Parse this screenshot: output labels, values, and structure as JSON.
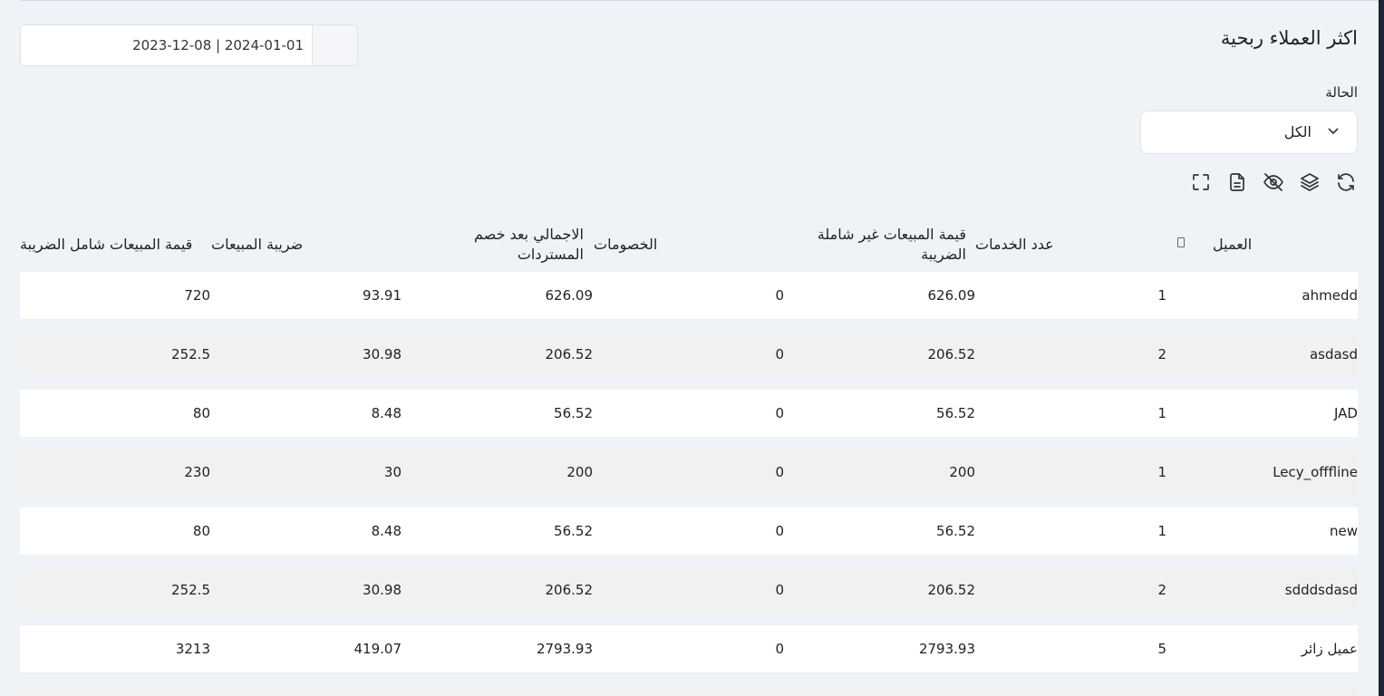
{
  "page": {
    "title": "اكثر العملاء ربحية",
    "date_range": "2023-12-08 | 2024-01-01"
  },
  "filter": {
    "status_label": "الحالة",
    "status_value": "الكل"
  },
  "toolbar": {
    "icons": [
      "refresh-icon",
      "layers-icon",
      "eye-off-icon",
      "document-icon",
      "fullscreen-icon"
    ]
  },
  "table": {
    "headers": {
      "client": "العميل",
      "services": "عدد الخدمات",
      "sales_excl": "قيمة المبيعات غير شاملة الضريبة",
      "discounts": "الخصومات",
      "total_after": "الاجمالي بعد خصم المستردات",
      "tax": "ضريبة المبيعات",
      "sales_incl": "قيمة المبيعات شامل الضريبة"
    },
    "rows": [
      {
        "client": "ahmedd",
        "services": "1",
        "sales_excl": "626.09",
        "discounts": "0",
        "total_after": "626.09",
        "tax": "93.91",
        "sales_incl": "720"
      },
      {
        "client": "asdasd",
        "services": "2",
        "sales_excl": "206.52",
        "discounts": "0",
        "total_after": "206.52",
        "tax": "30.98",
        "sales_incl": "252.5"
      },
      {
        "client": "JAD",
        "services": "1",
        "sales_excl": "56.52",
        "discounts": "0",
        "total_after": "56.52",
        "tax": "8.48",
        "sales_incl": "80"
      },
      {
        "client": "Lecy_offfline",
        "services": "1",
        "sales_excl": "200",
        "discounts": "0",
        "total_after": "200",
        "tax": "30",
        "sales_incl": "230"
      },
      {
        "client": "new",
        "services": "1",
        "sales_excl": "56.52",
        "discounts": "0",
        "total_after": "56.52",
        "tax": "8.48",
        "sales_incl": "80"
      },
      {
        "client": "sdddsdasd",
        "services": "2",
        "sales_excl": "206.52",
        "discounts": "0",
        "total_after": "206.52",
        "tax": "30.98",
        "sales_incl": "252.5"
      },
      {
        "client": "عميل زائر",
        "services": "5",
        "sales_excl": "2793.93",
        "discounts": "0",
        "total_after": "2793.93",
        "tax": "419.07",
        "sales_incl": "3213"
      }
    ]
  }
}
